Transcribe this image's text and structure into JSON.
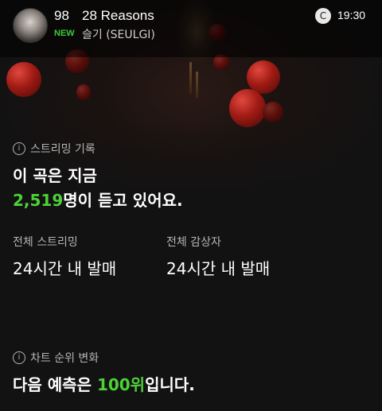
{
  "header": {
    "rank": "98",
    "title": "28 Reasons",
    "new_badge": "NEW",
    "artist": "슬기 (SEULGI)",
    "time": "19:30",
    "refresh_glyph": "C"
  },
  "streaming": {
    "section_title": "스트리밍 기록",
    "line1": "이 곡은 지금",
    "listener_count": "2,519",
    "line2_suffix": "명이 듣고 있어요.",
    "total_streaming_label": "전체 스트리밍",
    "total_streaming_value": "24시간 내 발매",
    "total_listeners_label": "전체 감상자",
    "total_listeners_value": "24시간 내 발매"
  },
  "chart_rank": {
    "section_title": "차트 순위 변화",
    "prefix": "다음 예측은 ",
    "predicted_rank": "100위",
    "suffix": "입니다."
  },
  "icons": {
    "info": "info-icon",
    "refresh": "refresh-icon"
  },
  "colors": {
    "accent_green": "#4cd137",
    "background": "#121212"
  }
}
